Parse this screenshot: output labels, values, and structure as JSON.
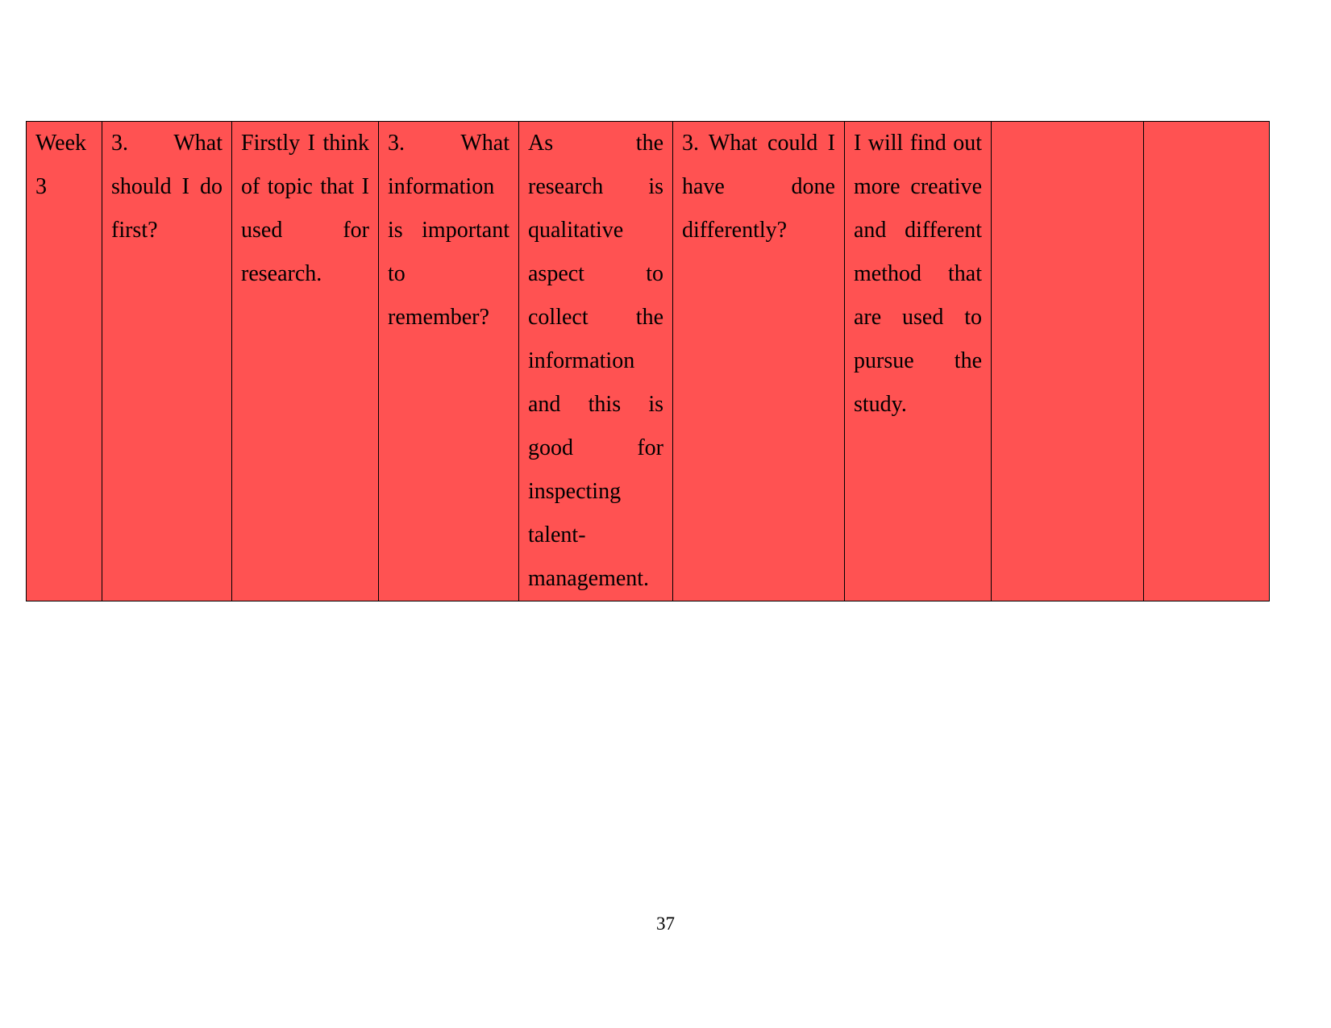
{
  "document": {
    "page_number": "37",
    "background_color": "#ffffff",
    "cell_fill_color": "#ff5252",
    "table": {
      "rows": [
        {
          "cells": [
            "Week 3",
            "3. What should I do first?",
            "Firstly I think of topic that I used for research.",
            "3. What information is important to remember?",
            "As the research is qualitative aspect to collect the information and this is good for inspecting talent-management.",
            "3. What could I have done differently?",
            "I will find out more creative and different method that are used to pursue the study.",
            "",
            ""
          ]
        }
      ]
    }
  }
}
